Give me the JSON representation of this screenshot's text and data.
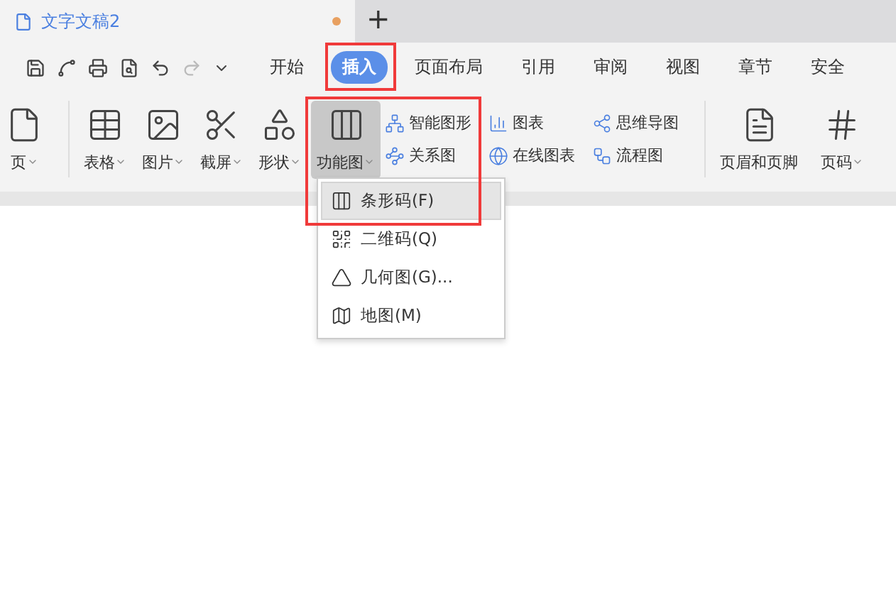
{
  "document_tab": {
    "title": "文字文稿2",
    "unsaved": true,
    "new_tab": "+"
  },
  "menu_tabs": [
    {
      "label": "开始",
      "selected": false
    },
    {
      "label": "插入",
      "selected": true
    },
    {
      "label": "页面布局",
      "selected": false
    },
    {
      "label": "引用",
      "selected": false
    },
    {
      "label": "审阅",
      "selected": false
    },
    {
      "label": "视图",
      "selected": false
    },
    {
      "label": "章节",
      "selected": false
    },
    {
      "label": "安全",
      "selected": false
    }
  ],
  "ribbon_large": [
    {
      "label": "页",
      "dropdown": true,
      "selected": false
    },
    {
      "label": "表格",
      "dropdown": true,
      "selected": false
    },
    {
      "label": "图片",
      "dropdown": true,
      "selected": false
    },
    {
      "label": "截屏",
      "dropdown": true,
      "selected": false
    },
    {
      "label": "形状",
      "dropdown": true,
      "selected": false
    },
    {
      "label": "功能图",
      "dropdown": true,
      "selected": true
    }
  ],
  "ribbon_small": [
    [
      {
        "label": "智能图形"
      },
      {
        "label": "关系图"
      }
    ],
    [
      {
        "label": "图表"
      },
      {
        "label": "在线图表"
      }
    ],
    [
      {
        "label": "思维导图"
      },
      {
        "label": "流程图"
      }
    ]
  ],
  "ribbon_right": [
    {
      "label": "页眉和页脚",
      "dropdown": false,
      "selected": false
    },
    {
      "label": "页码",
      "dropdown": true,
      "selected": false
    }
  ],
  "dropdown_menu": [
    {
      "label": "条形码(F)",
      "selected": true
    },
    {
      "label": "二维码(Q)",
      "selected": false
    },
    {
      "label": "几何图(G)...",
      "selected": false
    },
    {
      "label": "地图(M)",
      "selected": false
    }
  ]
}
